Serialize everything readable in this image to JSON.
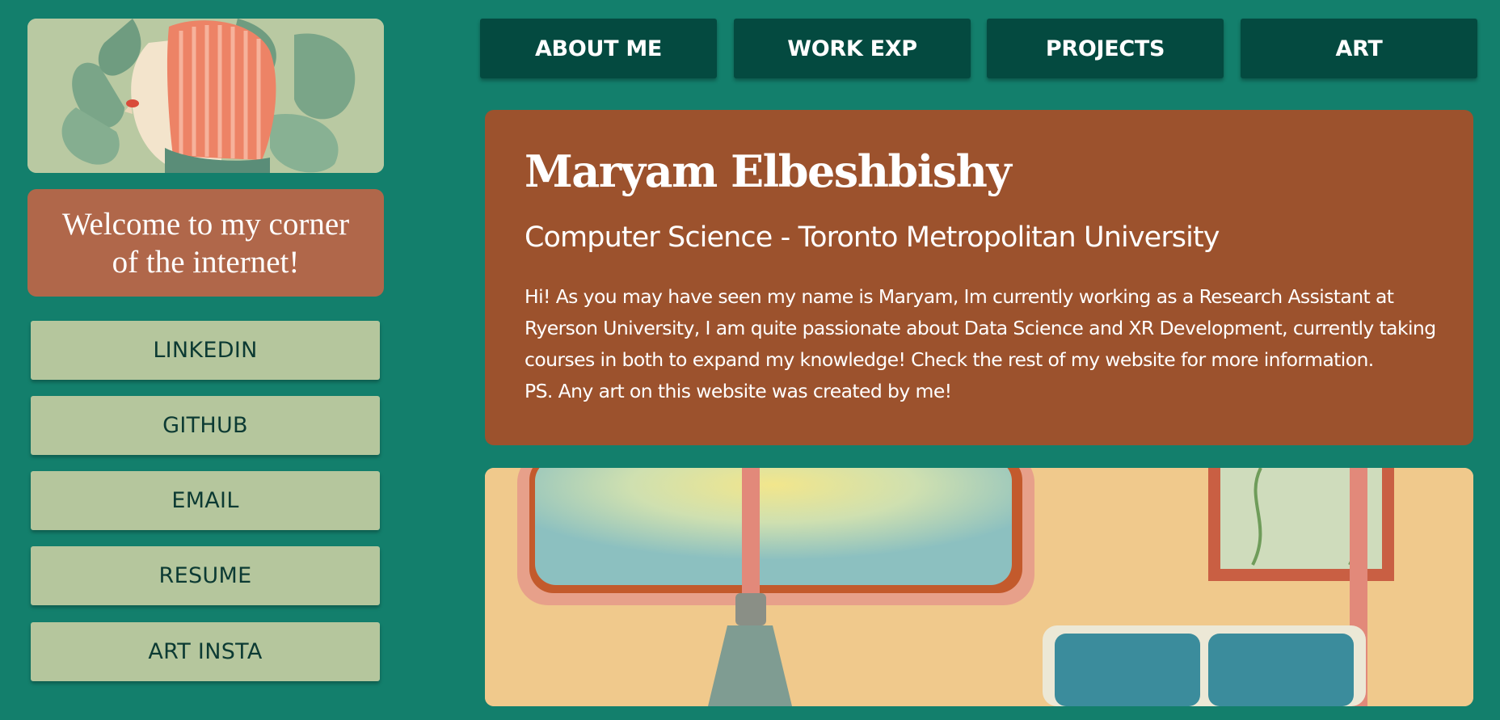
{
  "colors": {
    "background": "#137f6c",
    "nav_button": "#044a40",
    "link_button": "#b5c69d",
    "welcome_box": "#b0674a",
    "intro_card": "#9c522d"
  },
  "sidebar": {
    "avatar_alt": "illustrated portrait with red hair among leaves",
    "welcome_text": "Welcome to my corner of the internet!",
    "links": [
      {
        "label": "LINKEDIN"
      },
      {
        "label": "GITHUB"
      },
      {
        "label": "EMAIL"
      },
      {
        "label": "RESUME"
      },
      {
        "label": "ART INSTA"
      }
    ]
  },
  "nav": {
    "items": [
      {
        "label": "ABOUT ME"
      },
      {
        "label": "WORK EXP"
      },
      {
        "label": "PROJECTS"
      },
      {
        "label": "ART"
      }
    ]
  },
  "intro": {
    "name": "Maryam Elbeshbishy",
    "subtitle": "Computer Science - Toronto Metropolitan University",
    "bio": "Hi! As you may have seen my name is Maryam, Im currently working as a Research Assistant at Ryerson University, I am quite passionate about Data Science and XR Development, currently taking courses in both to expand my knowledge! Check the rest of my website for more information.",
    "ps": "PS. Any art on this website was created by me!"
  },
  "banner": {
    "alt": "painting of a subway car interior with window and seats"
  }
}
